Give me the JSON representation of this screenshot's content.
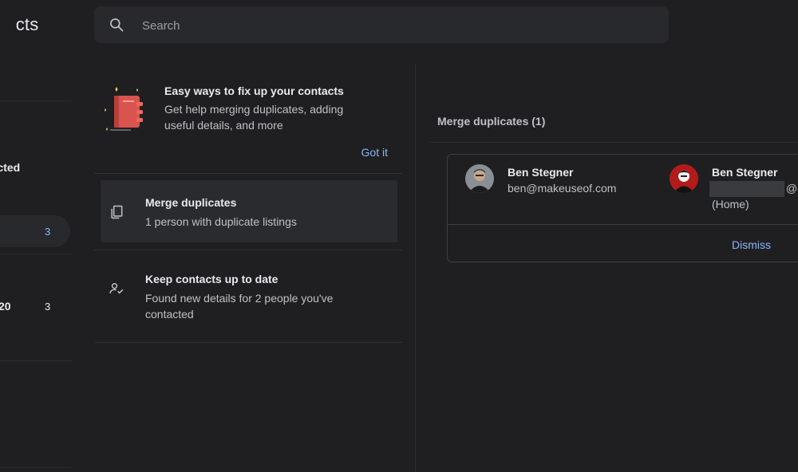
{
  "app": {
    "title_fragment": "cts"
  },
  "sidebar": {
    "label_fragment": "tacted",
    "active_item": {
      "count": "3"
    },
    "year_item": {
      "label_fragment": "20",
      "count": "3"
    }
  },
  "search": {
    "placeholder": "Search"
  },
  "promo": {
    "title": "Easy ways to fix up your contacts",
    "body": "Get help merging duplicates, adding useful details, and more",
    "action": "Got it"
  },
  "suggestions": [
    {
      "title": "Merge duplicates",
      "body": "1 person with duplicate listings",
      "icon": "copy-icon"
    },
    {
      "title": "Keep contacts up to date",
      "body": "Found new details for 2 people you've contacted",
      "icon": "person-check-icon"
    }
  ],
  "merge_panel": {
    "heading": "Merge duplicates (1)",
    "contacts": [
      {
        "name": "Ben Stegner",
        "email": "ben@makeuseof.com"
      },
      {
        "name": "Ben Stegner",
        "email_tail": "@g",
        "note": "(Home)"
      }
    ],
    "dismiss": "Dismiss"
  },
  "colors": {
    "accent": "#8ab4f8",
    "background": "#1f1f21",
    "surface": "#28292c"
  }
}
